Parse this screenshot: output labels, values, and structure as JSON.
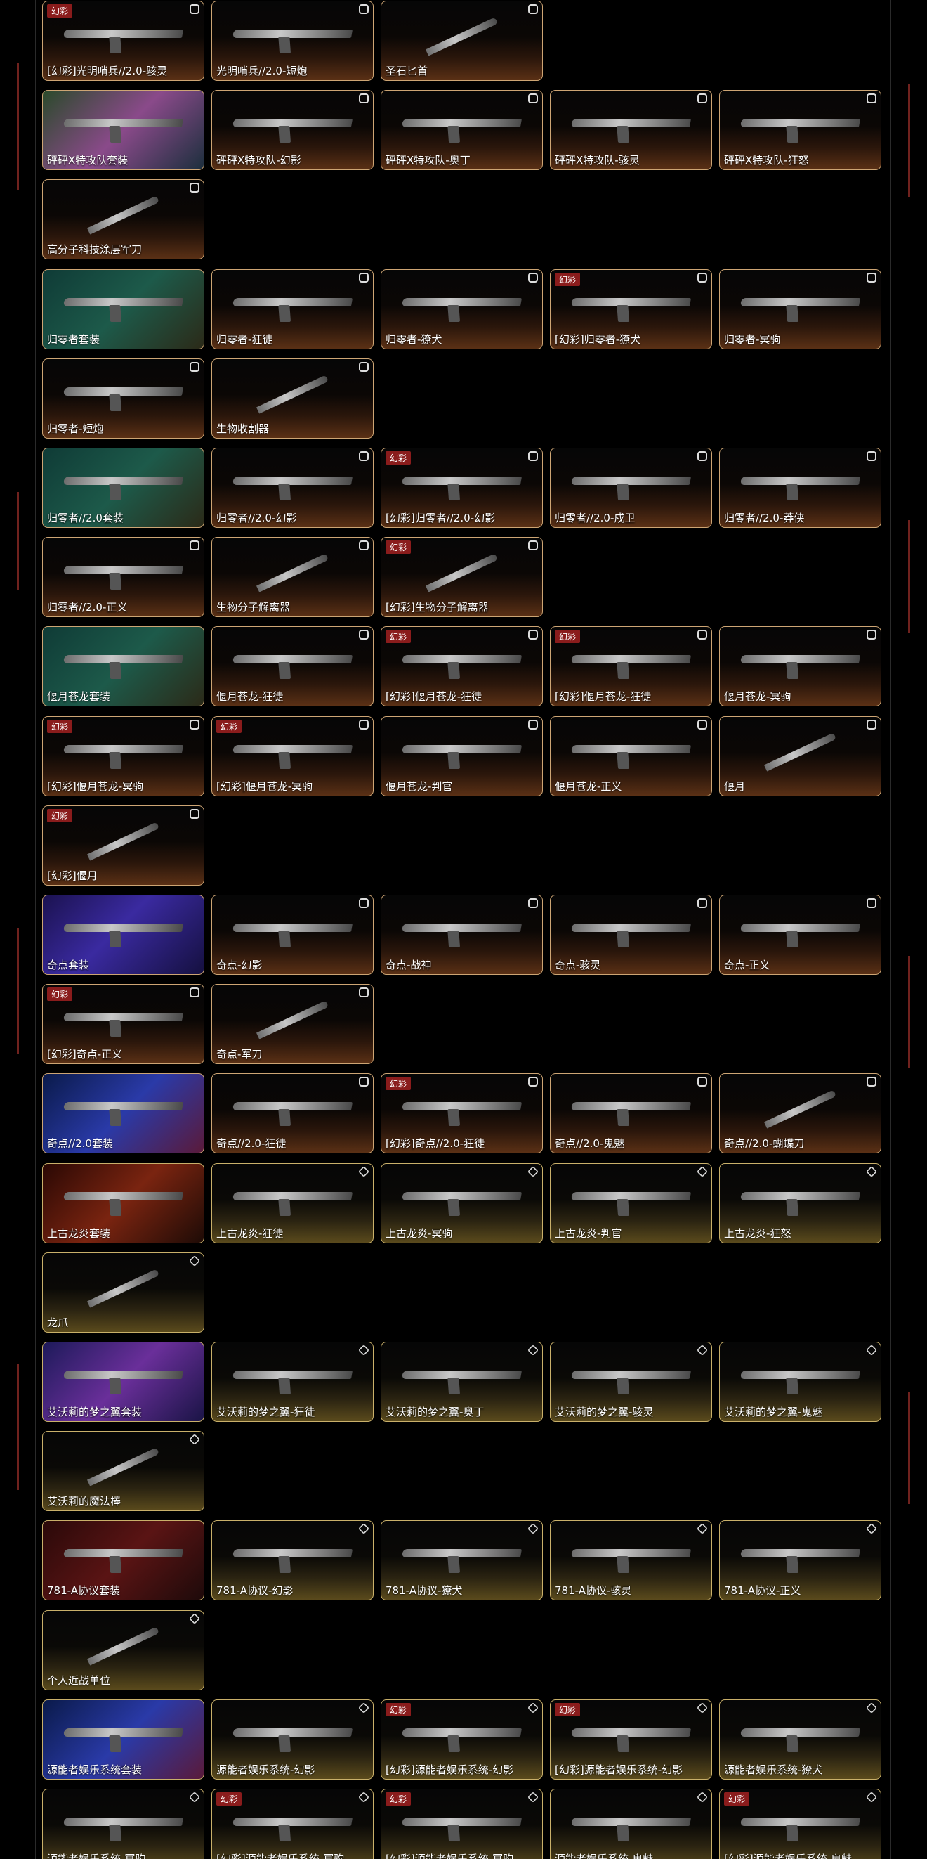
{
  "rows": [
    {
      "cards": [
        {
          "label": "[幻彩]光明哨兵//2.0-骇灵",
          "tag": "幻彩"
        },
        {
          "label": "光明哨兵//2.0-短炮"
        },
        {
          "label": "圣石匕首",
          "knife": true
        }
      ]
    },
    {
      "cards": [
        {
          "label": "砰砰X特攻队套装",
          "bundle": "green"
        },
        {
          "label": "砰砰X特攻队-幻影"
        },
        {
          "label": "砰砰X特攻队-奥丁"
        },
        {
          "label": "砰砰X特攻队-骇灵"
        },
        {
          "label": "砰砰X特攻队-狂怒"
        }
      ]
    },
    {
      "cards": [
        {
          "label": "高分子科技涂层军刀",
          "knife": true
        }
      ]
    },
    {
      "cards": [
        {
          "label": "归零者套装",
          "bundle": "teal"
        },
        {
          "label": "归零者-狂徒"
        },
        {
          "label": "归零者-獠犬"
        },
        {
          "label": "[幻彩]归零者-獠犬",
          "tag": "幻彩"
        },
        {
          "label": "归零者-冥驹"
        }
      ]
    },
    {
      "cards": [
        {
          "label": "归零者-短炮"
        },
        {
          "label": "生物收割器",
          "knife": true
        }
      ]
    },
    {
      "cards": [
        {
          "label": "归零者//2.0套装",
          "bundle": "teal"
        },
        {
          "label": "归零者//2.0-幻影"
        },
        {
          "label": "[幻彩]归零者//2.0-幻影",
          "tag": "幻彩"
        },
        {
          "label": "归零者//2.0-戍卫"
        },
        {
          "label": "归零者//2.0-莽侠"
        }
      ]
    },
    {
      "cards": [
        {
          "label": "归零者//2.0-正义"
        },
        {
          "label": "生物分子解离器",
          "knife": true
        },
        {
          "label": "[幻彩]生物分子解离器",
          "tag": "幻彩",
          "knife": true
        }
      ]
    },
    {
      "cards": [
        {
          "label": "偃月苍龙套装",
          "bundle": "teal"
        },
        {
          "label": "偃月苍龙-狂徒"
        },
        {
          "label": "[幻彩]偃月苍龙-狂徒",
          "tag": "幻彩"
        },
        {
          "label": "[幻彩]偃月苍龙-狂徒",
          "tag": "幻彩"
        },
        {
          "label": "偃月苍龙-冥驹"
        }
      ]
    },
    {
      "cards": [
        {
          "label": "[幻彩]偃月苍龙-冥驹",
          "tag": "幻彩"
        },
        {
          "label": "[幻彩]偃月苍龙-冥驹",
          "tag": "幻彩"
        },
        {
          "label": "偃月苍龙-判官"
        },
        {
          "label": "偃月苍龙-正义"
        },
        {
          "label": "偃月",
          "knife": true
        }
      ]
    },
    {
      "cards": [
        {
          "label": "[幻彩]偃月",
          "tag": "幻彩",
          "knife": true
        }
      ]
    },
    {
      "cards": [
        {
          "label": "奇点套装",
          "bundle": "purple"
        },
        {
          "label": "奇点-幻影"
        },
        {
          "label": "奇点-战神"
        },
        {
          "label": "奇点-骇灵"
        },
        {
          "label": "奇点-正义"
        }
      ]
    },
    {
      "cards": [
        {
          "label": "[幻彩]奇点-正义",
          "tag": "幻彩"
        },
        {
          "label": "奇点-军刀",
          "knife": true
        }
      ]
    },
    {
      "cards": [
        {
          "label": "奇点//2.0套装",
          "bundle": "blue"
        },
        {
          "label": "奇点//2.0-狂徒"
        },
        {
          "label": "[幻彩]奇点//2.0-狂徒",
          "tag": "幻彩"
        },
        {
          "label": "奇点//2.0-鬼魅"
        },
        {
          "label": "奇点//2.0-蝴蝶刀",
          "knife": true
        }
      ]
    },
    {
      "gold": true,
      "cards": [
        {
          "label": "上古龙炎套装",
          "bundle": "fire"
        },
        {
          "label": "上古龙炎-狂徒"
        },
        {
          "label": "上古龙炎-冥驹"
        },
        {
          "label": "上古龙炎-判官"
        },
        {
          "label": "上古龙炎-狂怒"
        }
      ]
    },
    {
      "gold": true,
      "cards": [
        {
          "label": "龙爪",
          "knife": true
        }
      ]
    },
    {
      "gold": true,
      "cards": [
        {
          "label": "艾沃莉的梦之翼套装",
          "bundle": "neon"
        },
        {
          "label": "艾沃莉的梦之翼-狂徒"
        },
        {
          "label": "艾沃莉的梦之翼-奥丁"
        },
        {
          "label": "艾沃莉的梦之翼-骇灵"
        },
        {
          "label": "艾沃莉的梦之翼-鬼魅"
        }
      ]
    },
    {
      "gold": true,
      "cards": [
        {
          "label": "艾沃莉的魔法棒",
          "knife": true
        }
      ]
    },
    {
      "gold": true,
      "cards": [
        {
          "label": "781-A协议套装",
          "bundle": "red"
        },
        {
          "label": "781-A协议-幻影"
        },
        {
          "label": "781-A协议-獠犬"
        },
        {
          "label": "781-A协议-骇灵"
        },
        {
          "label": "781-A协议-正义"
        }
      ]
    },
    {
      "gold": true,
      "cards": [
        {
          "label": "个人近战单位",
          "knife": true
        }
      ]
    },
    {
      "gold": true,
      "cards": [
        {
          "label": "源能者娱乐系统套装",
          "bundle": "blue"
        },
        {
          "label": "源能者娱乐系统-幻影"
        },
        {
          "label": "[幻彩]源能者娱乐系统-幻影",
          "tag": "幻彩"
        },
        {
          "label": "[幻彩]源能者娱乐系统-幻影",
          "tag": "幻彩"
        },
        {
          "label": "源能者娱乐系统-獠犬"
        }
      ]
    },
    {
      "gold": true,
      "cards": [
        {
          "label": "源能者娱乐系统-冥驹"
        },
        {
          "label": "[幻彩]源能者娱乐系统-冥驹",
          "tag": "幻彩"
        },
        {
          "label": "[幻彩]源能者娱乐系统-冥驹",
          "tag": "幻彩"
        },
        {
          "label": "源能者娱乐系统-鬼魅"
        },
        {
          "label": "[幻彩]源能者娱乐系统-鬼魅",
          "tag": "幻彩"
        }
      ]
    }
  ]
}
